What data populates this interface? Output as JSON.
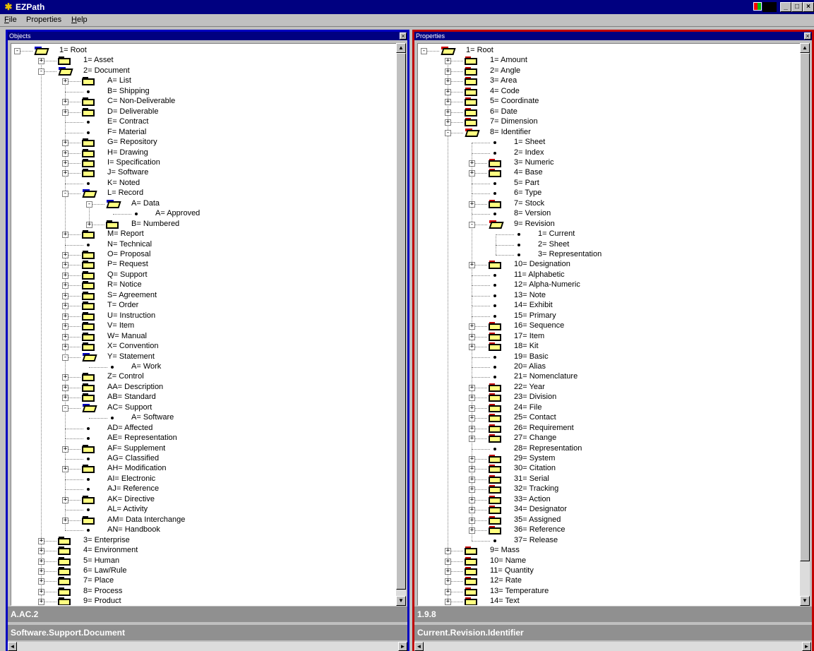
{
  "window": {
    "title": "EZPath",
    "app_icon": "ezpath-icon",
    "minimize": "_",
    "maximize": "□",
    "close": "×"
  },
  "menu": [
    {
      "label": "File",
      "underline": "F",
      "rest": "ile"
    },
    {
      "label": "Properties"
    },
    {
      "label": "Help",
      "underline": "H",
      "rest": "elp"
    }
  ],
  "objects": {
    "title": "Objects",
    "status_path": "A.AC.2",
    "status_name": "Software.Support.Document",
    "nodes": [
      {
        "d": 0,
        "t": "1= Root",
        "k": "open",
        "pm": "-"
      },
      {
        "d": 1,
        "t": "1= Asset",
        "k": "closed",
        "pm": "+"
      },
      {
        "d": 1,
        "t": "2= Document",
        "k": "open",
        "pm": "-"
      },
      {
        "d": 2,
        "t": "A= List",
        "k": "closed",
        "pm": "+"
      },
      {
        "d": 2,
        "t": "B= Shipping",
        "k": "leaf"
      },
      {
        "d": 2,
        "t": "C= Non-Deliverable",
        "k": "closed",
        "pm": "+"
      },
      {
        "d": 2,
        "t": "D= Deliverable",
        "k": "closed",
        "pm": "+"
      },
      {
        "d": 2,
        "t": "E= Contract",
        "k": "leaf"
      },
      {
        "d": 2,
        "t": "F= Material",
        "k": "leaf"
      },
      {
        "d": 2,
        "t": "G= Repository",
        "k": "closed",
        "pm": "+"
      },
      {
        "d": 2,
        "t": "H= Drawing",
        "k": "closed",
        "pm": "+"
      },
      {
        "d": 2,
        "t": "I= Specification",
        "k": "closed",
        "pm": "+"
      },
      {
        "d": 2,
        "t": "J= Software",
        "k": "closed",
        "pm": "+"
      },
      {
        "d": 2,
        "t": "K= Noted",
        "k": "leaf"
      },
      {
        "d": 2,
        "t": "L= Record",
        "k": "open",
        "pm": "-"
      },
      {
        "d": 3,
        "t": "A= Data",
        "k": "open",
        "pm": "-"
      },
      {
        "d": 4,
        "t": "A= Approved",
        "k": "leaf"
      },
      {
        "d": 3,
        "t": "B= Numbered",
        "k": "closed",
        "pm": "+"
      },
      {
        "d": 2,
        "t": "M= Report",
        "k": "closed",
        "pm": "+"
      },
      {
        "d": 2,
        "t": "N= Technical",
        "k": "leaf"
      },
      {
        "d": 2,
        "t": "O= Proposal",
        "k": "closed",
        "pm": "+"
      },
      {
        "d": 2,
        "t": "P= Request",
        "k": "closed",
        "pm": "+"
      },
      {
        "d": 2,
        "t": "Q= Support",
        "k": "closed",
        "pm": "+"
      },
      {
        "d": 2,
        "t": "R= Notice",
        "k": "closed",
        "pm": "+"
      },
      {
        "d": 2,
        "t": "S= Agreement",
        "k": "closed",
        "pm": "+"
      },
      {
        "d": 2,
        "t": "T= Order",
        "k": "closed",
        "pm": "+"
      },
      {
        "d": 2,
        "t": "U= Instruction",
        "k": "closed",
        "pm": "+"
      },
      {
        "d": 2,
        "t": "V= Item",
        "k": "closed",
        "pm": "+"
      },
      {
        "d": 2,
        "t": "W= Manual",
        "k": "closed",
        "pm": "+"
      },
      {
        "d": 2,
        "t": "X= Convention",
        "k": "closed",
        "pm": "+"
      },
      {
        "d": 2,
        "t": "Y= Statement",
        "k": "open",
        "pm": "-"
      },
      {
        "d": 3,
        "t": "A= Work",
        "k": "leaf"
      },
      {
        "d": 2,
        "t": "Z= Control",
        "k": "closed",
        "pm": "+"
      },
      {
        "d": 2,
        "t": "AA= Description",
        "k": "closed",
        "pm": "+"
      },
      {
        "d": 2,
        "t": "AB= Standard",
        "k": "closed",
        "pm": "+"
      },
      {
        "d": 2,
        "t": "AC= Support",
        "k": "open",
        "pm": "-"
      },
      {
        "d": 3,
        "t": "A= Software",
        "k": "leaf"
      },
      {
        "d": 2,
        "t": "AD= Affected",
        "k": "leaf"
      },
      {
        "d": 2,
        "t": "AE= Representation",
        "k": "leaf"
      },
      {
        "d": 2,
        "t": "AF= Supplement",
        "k": "closed",
        "pm": "+"
      },
      {
        "d": 2,
        "t": "AG= Classified",
        "k": "leaf"
      },
      {
        "d": 2,
        "t": "AH= Modification",
        "k": "closed",
        "pm": "+"
      },
      {
        "d": 2,
        "t": "AI= Electronic",
        "k": "leaf"
      },
      {
        "d": 2,
        "t": "AJ= Reference",
        "k": "leaf"
      },
      {
        "d": 2,
        "t": "AK= Directive",
        "k": "closed",
        "pm": "+"
      },
      {
        "d": 2,
        "t": "AL= Activity",
        "k": "leaf"
      },
      {
        "d": 2,
        "t": "AM= Data Interchange",
        "k": "closed",
        "pm": "+"
      },
      {
        "d": 2,
        "t": "AN= Handbook",
        "k": "leaf"
      },
      {
        "d": 1,
        "t": "3= Enterprise",
        "k": "closed",
        "pm": "+"
      },
      {
        "d": 1,
        "t": "4= Environment",
        "k": "closed",
        "pm": "+"
      },
      {
        "d": 1,
        "t": "5= Human",
        "k": "closed",
        "pm": "+"
      },
      {
        "d": 1,
        "t": "6= Law/Rule",
        "k": "closed",
        "pm": "+"
      },
      {
        "d": 1,
        "t": "7= Place",
        "k": "closed",
        "pm": "+"
      },
      {
        "d": 1,
        "t": "8= Process",
        "k": "closed",
        "pm": "+"
      },
      {
        "d": 1,
        "t": "9= Product",
        "k": "closed",
        "pm": "+"
      }
    ]
  },
  "properties": {
    "title": "Properties",
    "status_path": "1.9.8",
    "status_name": "Current.Revision.Identifier",
    "nodes": [
      {
        "d": 0,
        "t": "1= Root",
        "k": "open",
        "pm": "-"
      },
      {
        "d": 1,
        "t": "1= Amount",
        "k": "closed",
        "pm": "+"
      },
      {
        "d": 1,
        "t": "2= Angle",
        "k": "closed",
        "pm": "+"
      },
      {
        "d": 1,
        "t": "3= Area",
        "k": "closed",
        "pm": "+"
      },
      {
        "d": 1,
        "t": "4= Code",
        "k": "closed",
        "pm": "+"
      },
      {
        "d": 1,
        "t": "5= Coordinate",
        "k": "closed",
        "pm": "+"
      },
      {
        "d": 1,
        "t": "6= Date",
        "k": "closed",
        "pm": "+"
      },
      {
        "d": 1,
        "t": "7= Dimension",
        "k": "closed",
        "pm": "+"
      },
      {
        "d": 1,
        "t": "8= Identifier",
        "k": "open",
        "pm": "-"
      },
      {
        "d": 2,
        "t": "1= Sheet",
        "k": "leaf"
      },
      {
        "d": 2,
        "t": "2= Index",
        "k": "leaf"
      },
      {
        "d": 2,
        "t": "3= Numeric",
        "k": "closed",
        "pm": "+"
      },
      {
        "d": 2,
        "t": "4= Base",
        "k": "closed",
        "pm": "+"
      },
      {
        "d": 2,
        "t": "5= Part",
        "k": "leaf"
      },
      {
        "d": 2,
        "t": "6= Type",
        "k": "leaf"
      },
      {
        "d": 2,
        "t": "7= Stock",
        "k": "closed",
        "pm": "+"
      },
      {
        "d": 2,
        "t": "8= Version",
        "k": "leaf"
      },
      {
        "d": 2,
        "t": "9= Revision",
        "k": "open",
        "pm": "-"
      },
      {
        "d": 3,
        "t": "1= Current",
        "k": "leaf"
      },
      {
        "d": 3,
        "t": "2= Sheet",
        "k": "leaf"
      },
      {
        "d": 3,
        "t": "3= Representation",
        "k": "leaf"
      },
      {
        "d": 2,
        "t": "10= Designation",
        "k": "closed",
        "pm": "+"
      },
      {
        "d": 2,
        "t": "11= Alphabetic",
        "k": "leaf"
      },
      {
        "d": 2,
        "t": "12= Alpha-Numeric",
        "k": "leaf"
      },
      {
        "d": 2,
        "t": "13= Note",
        "k": "leaf"
      },
      {
        "d": 2,
        "t": "14= Exhibit",
        "k": "leaf"
      },
      {
        "d": 2,
        "t": "15= Primary",
        "k": "leaf"
      },
      {
        "d": 2,
        "t": "16= Sequence",
        "k": "closed",
        "pm": "+"
      },
      {
        "d": 2,
        "t": "17= Item",
        "k": "closed",
        "pm": "+"
      },
      {
        "d": 2,
        "t": "18= Kit",
        "k": "closed",
        "pm": "+"
      },
      {
        "d": 2,
        "t": "19= Basic",
        "k": "leaf"
      },
      {
        "d": 2,
        "t": "20= Alias",
        "k": "leaf"
      },
      {
        "d": 2,
        "t": "21= Nomenclature",
        "k": "leaf"
      },
      {
        "d": 2,
        "t": "22= Year",
        "k": "closed",
        "pm": "+"
      },
      {
        "d": 2,
        "t": "23= Division",
        "k": "closed",
        "pm": "+"
      },
      {
        "d": 2,
        "t": "24= File",
        "k": "closed",
        "pm": "+"
      },
      {
        "d": 2,
        "t": "25= Contact",
        "k": "closed",
        "pm": "+"
      },
      {
        "d": 2,
        "t": "26= Requirement",
        "k": "closed",
        "pm": "+"
      },
      {
        "d": 2,
        "t": "27= Change",
        "k": "closed",
        "pm": "+"
      },
      {
        "d": 2,
        "t": "28= Representation",
        "k": "leaf"
      },
      {
        "d": 2,
        "t": "29= System",
        "k": "closed",
        "pm": "+"
      },
      {
        "d": 2,
        "t": "30= Citation",
        "k": "closed",
        "pm": "+"
      },
      {
        "d": 2,
        "t": "31= Serial",
        "k": "closed",
        "pm": "+"
      },
      {
        "d": 2,
        "t": "32= Tracking",
        "k": "closed",
        "pm": "+"
      },
      {
        "d": 2,
        "t": "33= Action",
        "k": "closed",
        "pm": "+"
      },
      {
        "d": 2,
        "t": "34= Designator",
        "k": "closed",
        "pm": "+"
      },
      {
        "d": 2,
        "t": "35= Assigned",
        "k": "closed",
        "pm": "+"
      },
      {
        "d": 2,
        "t": "36= Reference",
        "k": "closed",
        "pm": "+"
      },
      {
        "d": 2,
        "t": "37= Release",
        "k": "leaf"
      },
      {
        "d": 1,
        "t": "9= Mass",
        "k": "closed",
        "pm": "+"
      },
      {
        "d": 1,
        "t": "10= Name",
        "k": "closed",
        "pm": "+"
      },
      {
        "d": 1,
        "t": "11= Quantity",
        "k": "closed",
        "pm": "+"
      },
      {
        "d": 1,
        "t": "12= Rate",
        "k": "closed",
        "pm": "+"
      },
      {
        "d": 1,
        "t": "13= Temperature",
        "k": "closed",
        "pm": "+"
      },
      {
        "d": 1,
        "t": "14= Text",
        "k": "closed",
        "pm": "+"
      }
    ]
  },
  "colors": {
    "title_bar": "#000080",
    "objects_border": "#0000c0",
    "properties_border": "#c00000",
    "folder": "#ffff80",
    "open_tab_objects": "#0000c0",
    "open_tab_properties": "#d00000"
  }
}
